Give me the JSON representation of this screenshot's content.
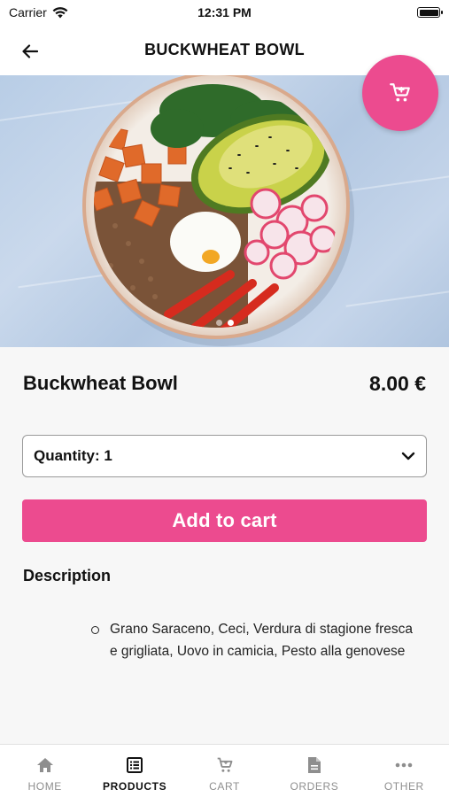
{
  "status_bar": {
    "carrier": "Carrier",
    "time": "12:31 PM"
  },
  "header": {
    "title": "BUCKWHEAT BOWL"
  },
  "gallery": {
    "image_description_icon": "food-bowl-photo",
    "page_count": 2,
    "active_page": 2
  },
  "product": {
    "name": "Buckwheat Bowl",
    "price": "8.00 €"
  },
  "quantity_select": {
    "label": "Quantity: 1"
  },
  "actions": {
    "add_to_cart_label": "Add to cart"
  },
  "description": {
    "heading": "Description",
    "items": [
      "Grano Saraceno, Ceci, Verdura di stagione fresca e grigliata, Uovo in camicia, Pesto alla genovese"
    ]
  },
  "tab_bar": {
    "tabs": [
      {
        "label": "HOME",
        "icon": "home-icon",
        "active": false
      },
      {
        "label": "PRODUCTS",
        "icon": "list-icon",
        "active": true
      },
      {
        "label": "CART",
        "icon": "cart-icon",
        "active": false
      },
      {
        "label": "ORDERS",
        "icon": "document-icon",
        "active": false
      },
      {
        "label": "OTHER",
        "icon": "more-icon",
        "active": false
      }
    ]
  },
  "colors": {
    "accent": "#ec4b8f",
    "inactive_tab": "#8e8e8e"
  }
}
